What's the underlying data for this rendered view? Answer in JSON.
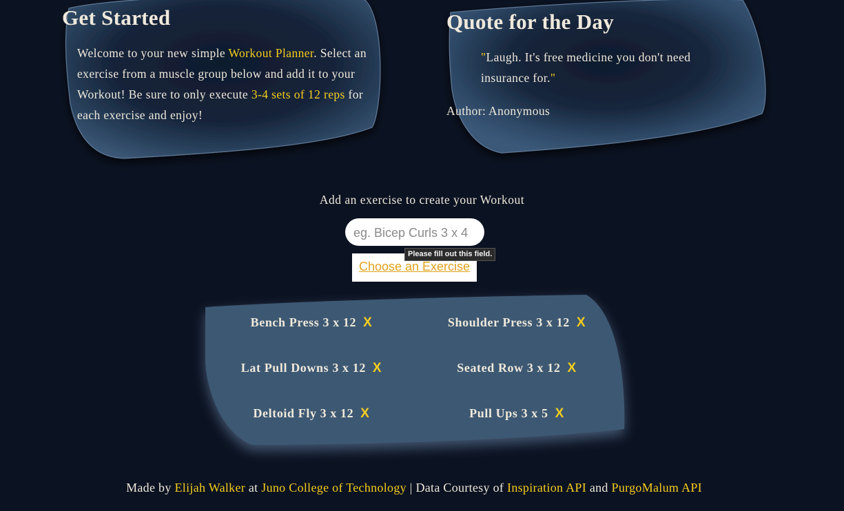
{
  "get_started": {
    "title": "Get Started",
    "text_1": "Welcome to your new simple ",
    "highlight_1": "Workout Planner",
    "text_2": ". Select an exercise from a muscle group below and add it to your Workout! Be sure to only execute ",
    "highlight_2": "3-4 sets of 12 reps",
    "text_3": " for each exercise and enjoy!"
  },
  "quote": {
    "title": "Quote for the Day",
    "open_mark": "\"",
    "text": "Laugh. It's free medicine you don't need insurance for.",
    "close_mark": "\"",
    "author": "Author: Anonymous"
  },
  "form": {
    "label": "Add an exercise to create your Workout",
    "input_placeholder": "eg. Bicep Curls 3 x 4",
    "input_value": "",
    "tooltip": "Please fill out this field.",
    "choose_button": "Choose an Exercise"
  },
  "workout": {
    "remove_label": "X",
    "exercises": [
      {
        "label": "Bench Press 3 x 12"
      },
      {
        "label": "Shoulder Press 3 x 12"
      },
      {
        "label": "Lat Pull Downs 3 x 12"
      },
      {
        "label": "Seated Row 3 x 12"
      },
      {
        "label": "Deltoid Fly 3 x 12"
      },
      {
        "label": "Pull Ups 3 x 5"
      }
    ]
  },
  "footer": {
    "made_by": "Made by ",
    "author_link": "Elijah Walker",
    "at": " at ",
    "school_link": "Juno College of Technology",
    "data_courtesy": " | Data Courtesy of ",
    "api_link_1": "Inspiration API",
    "and": " and ",
    "api_link_2": "PurgoMalum API"
  },
  "colors": {
    "background": "#0b1221",
    "card": "#1f3048",
    "list_panel": "#3e5872",
    "accent": "#f5cd1f",
    "text": "#efe9dc"
  }
}
